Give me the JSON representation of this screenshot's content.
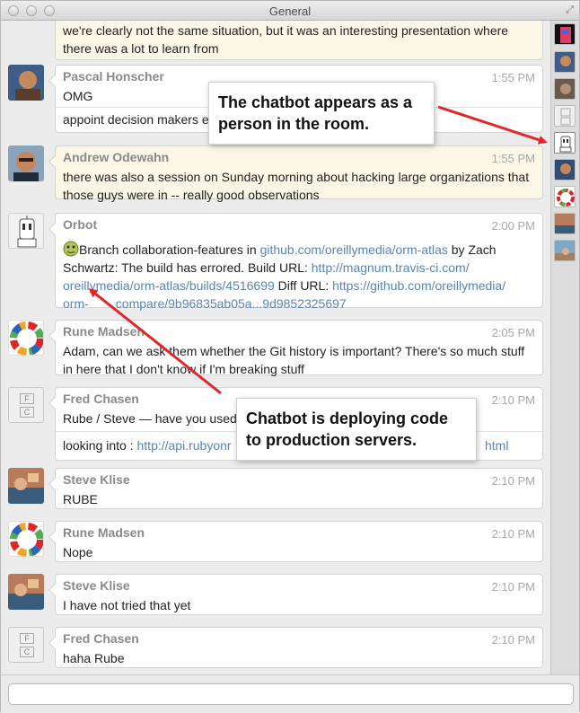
{
  "window": {
    "title": "General"
  },
  "messages": [
    {
      "id": "m0",
      "name": "",
      "time": "",
      "lines": [
        "we're clearly not the same situation, but it was an interesting presentation where",
        "there was a lot to learn from"
      ],
      "highlight": true
    },
    {
      "id": "m1",
      "name": "Pascal Honscher",
      "time": "1:55 PM",
      "lines": [
        "OMG"
      ],
      "second": "appoint decision makers e"
    },
    {
      "id": "m2",
      "name": "Andrew Odewahn",
      "time": "1:55 PM",
      "lines": [
        "there was also a session on Sunday morning about hacking large organizations that",
        "those guys were in -- really good observations"
      ],
      "highlight": true
    },
    {
      "id": "m3",
      "name": "Orbot",
      "time": "2:00 PM"
    },
    {
      "id": "m4",
      "name": "Rune Madsen",
      "time": "2:05 PM",
      "lines": [
        "Adam, can we ask them whether the Git history is important? There's so much stuff",
        "in here that I don't know if I'm breaking stuff"
      ]
    },
    {
      "id": "m5",
      "name": "Fred Chasen",
      "time": "2:10 PM",
      "lines": [
        "Rube / Steve — have you used"
      ],
      "second_prefix": "looking into : ",
      "second_link_a": "http://api.rubyonr",
      "second_link_b": "html"
    },
    {
      "id": "m6",
      "name": "Steve Klise",
      "time": "2:10 PM",
      "lines": [
        "RUBE"
      ]
    },
    {
      "id": "m7",
      "name": "Rune Madsen",
      "time": "2:10 PM",
      "lines": [
        "Nope"
      ]
    },
    {
      "id": "m8",
      "name": "Steve Klise",
      "time": "2:10 PM",
      "lines": [
        "I have not tried that yet"
      ]
    },
    {
      "id": "m9",
      "name": "Fred Chasen",
      "time": "2:10 PM",
      "lines": [
        "haha Rube"
      ]
    }
  ],
  "orbot": {
    "t1": "Branch collaboration-features in ",
    "link1": "github.com/oreillymedia/orm-atlas",
    "t2": " by Zach",
    "t3": "Schwartz: The build has errored. Build URL: ",
    "link2": "http://magnum.travis-ci.com/",
    "link3": "oreillymedia/orm-atlas/builds/4516699",
    "t4": " Diff URL: ",
    "link4": "https://github.com/oreillymedia/",
    "link5": "orm-",
    "link6": "compare/9b96835ab05a...9d9852325697"
  },
  "callouts": {
    "top": "The chatbot appears as a person in the room.",
    "bottom": "Chatbot is deploying code to production servers."
  },
  "avatar_initials": {
    "fc": [
      "F",
      "C"
    ]
  },
  "input": {
    "placeholder": ""
  },
  "colors": {
    "highlight_bg": "#fbf7e6",
    "link": "#5a84b6",
    "arrow": "#e0262b"
  }
}
